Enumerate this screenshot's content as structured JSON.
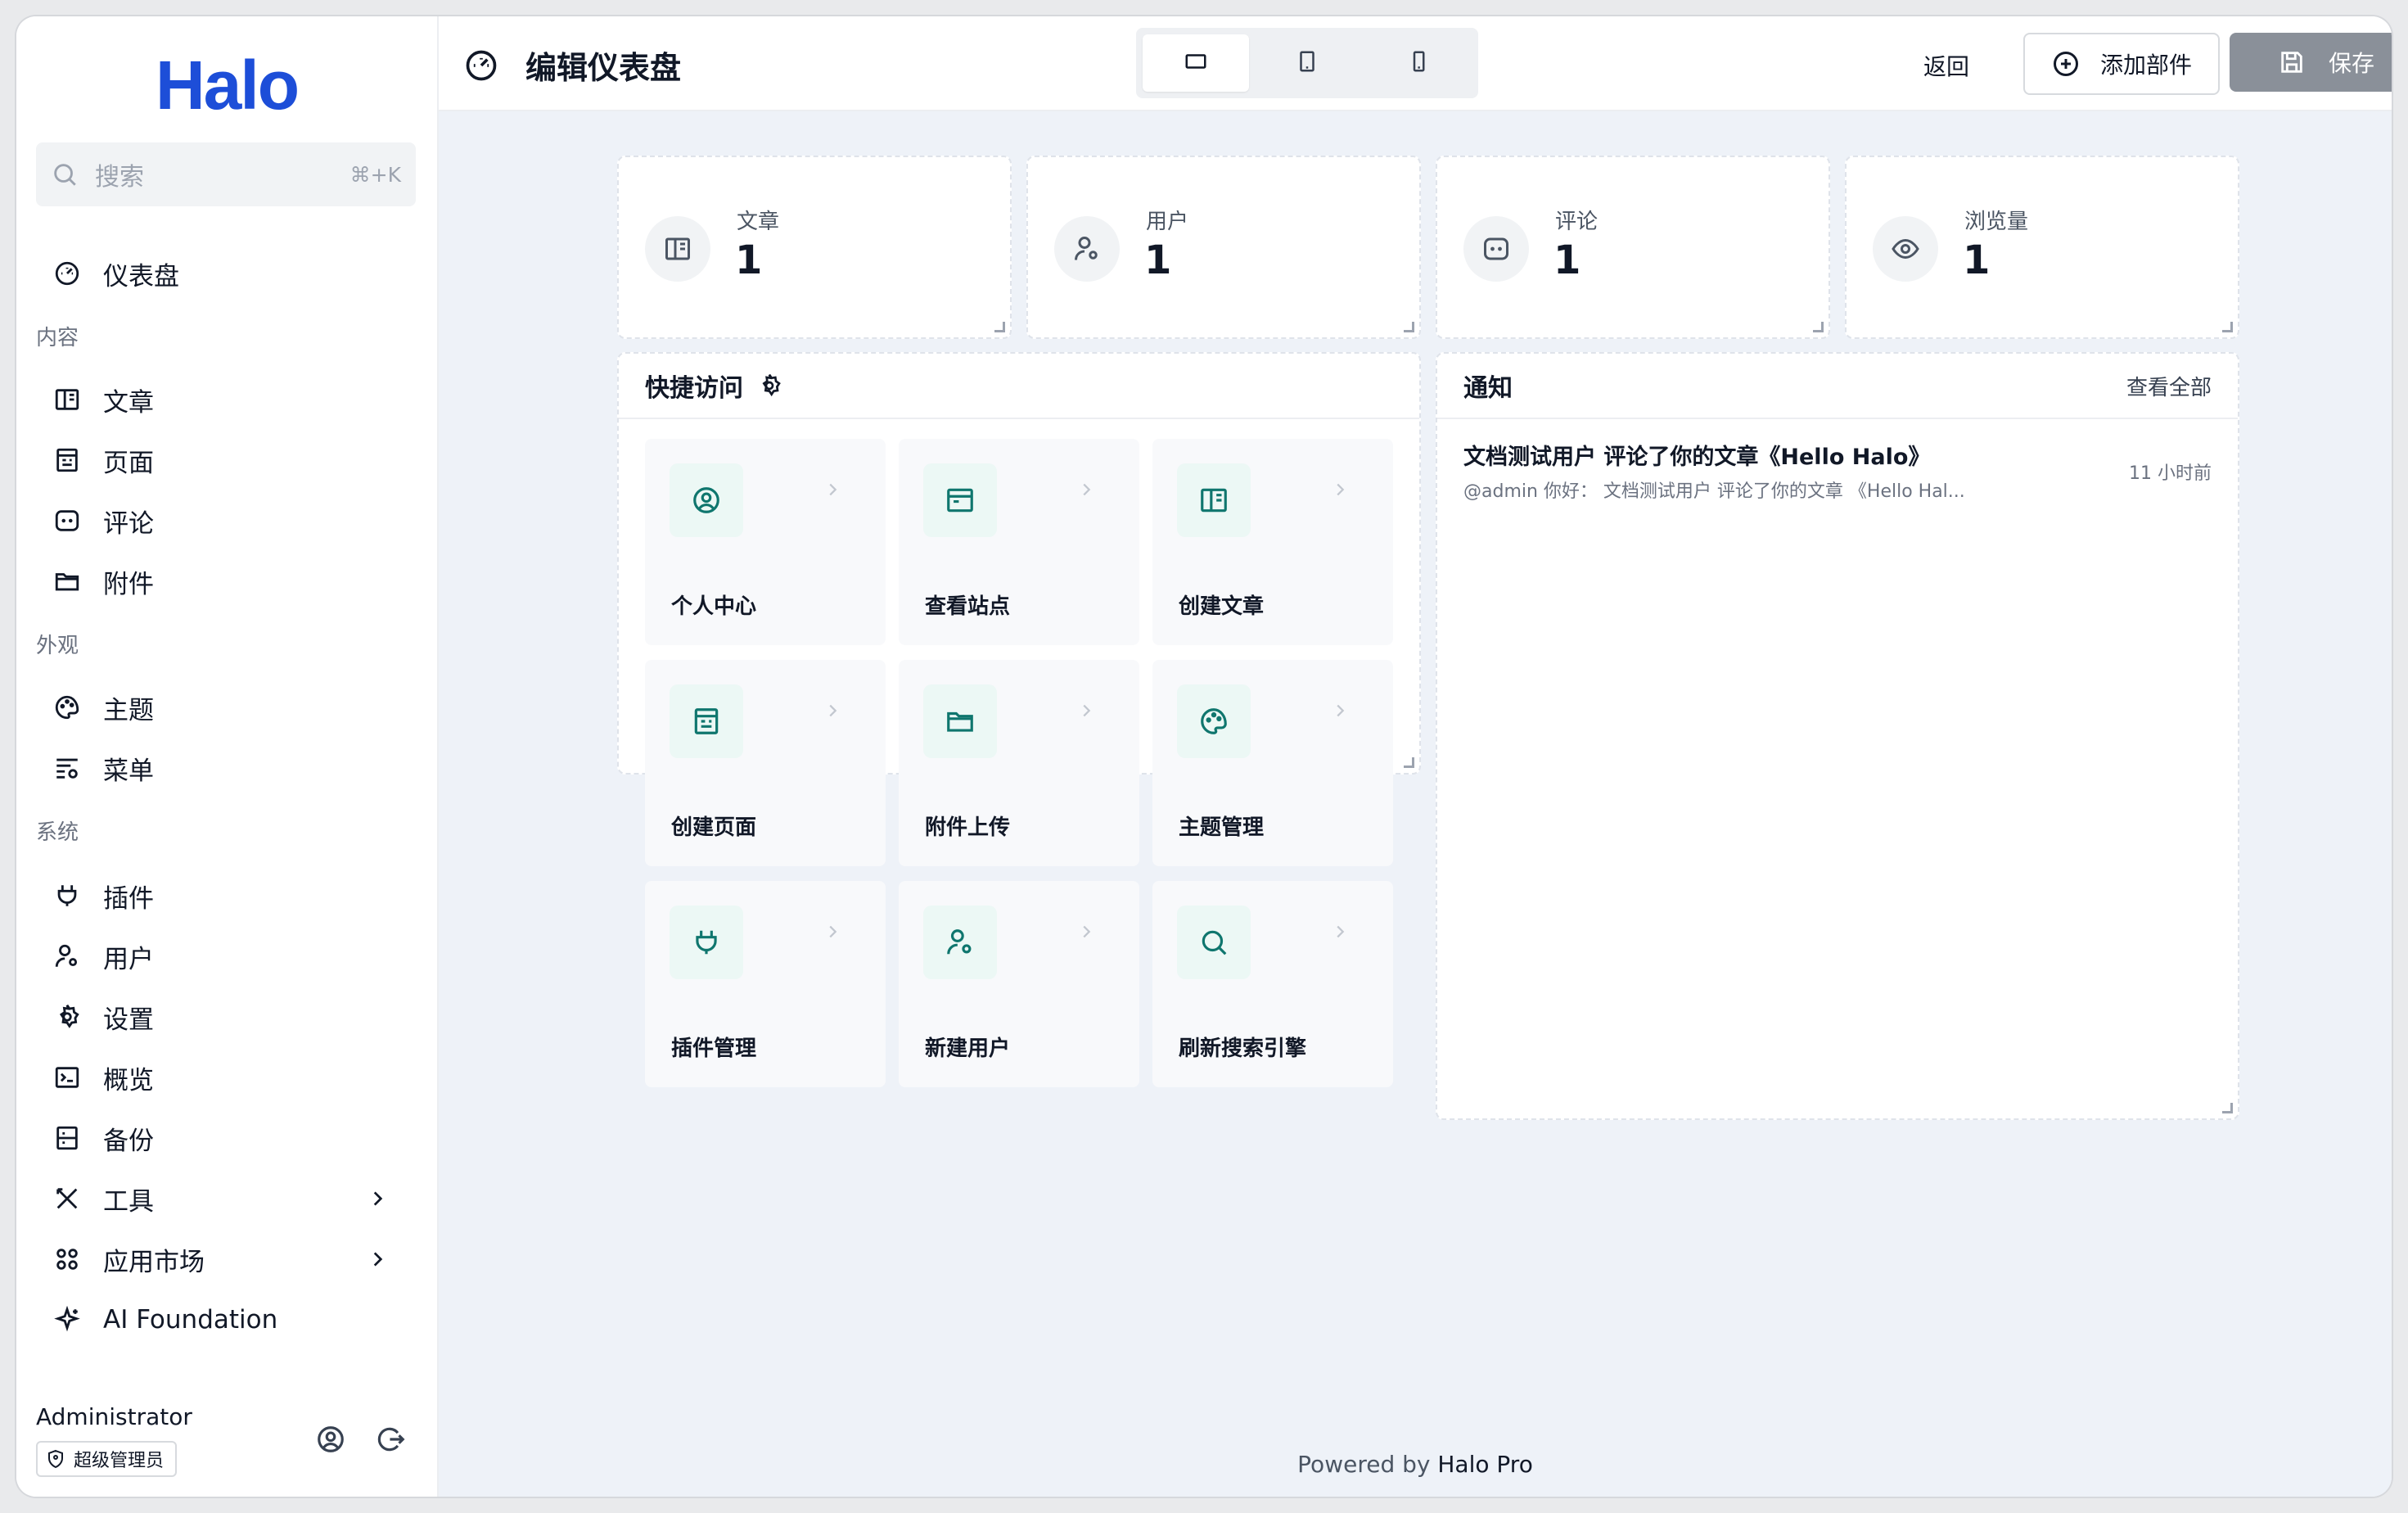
{
  "colors": {
    "brand": "#1d4ed8",
    "accent": "#0f766e",
    "save_disabled": "#8a9099",
    "content_bg": "#eef2f8"
  },
  "sidebar": {
    "logo": "Halo",
    "search": {
      "placeholder": "搜索",
      "shortcut": "⌘+K"
    },
    "dashboard": {
      "label": "仪表盘",
      "icon": "dashboard-icon"
    },
    "groups": [
      {
        "title": "内容",
        "items": [
          {
            "label": "文章",
            "icon": "post-icon"
          },
          {
            "label": "页面",
            "icon": "page-icon"
          },
          {
            "label": "评论",
            "icon": "comment-icon"
          },
          {
            "label": "附件",
            "icon": "folder-icon"
          }
        ]
      },
      {
        "title": "外观",
        "items": [
          {
            "label": "主题",
            "icon": "palette-icon"
          },
          {
            "label": "菜单",
            "icon": "menu-icon"
          }
        ]
      },
      {
        "title": "系统",
        "items": [
          {
            "label": "插件",
            "icon": "plug-icon"
          },
          {
            "label": "用户",
            "icon": "user-settings-icon"
          },
          {
            "label": "设置",
            "icon": "gear-icon"
          },
          {
            "label": "概览",
            "icon": "terminal-icon"
          },
          {
            "label": "备份",
            "icon": "backup-icon"
          },
          {
            "label": "工具",
            "icon": "tools-icon"
          },
          {
            "label": "应用市场",
            "icon": "apps-icon"
          },
          {
            "label": "AI Foundation",
            "icon": "sparkle-icon"
          }
        ]
      }
    ],
    "profile": {
      "name": "Administrator",
      "role": "超级管理员"
    }
  },
  "header": {
    "title": "编辑仪表盘",
    "back_label": "返回",
    "add_widget_label": "添加部件",
    "save_label": "保存",
    "devices": [
      "desktop",
      "tablet",
      "mobile"
    ],
    "active_device": "desktop"
  },
  "stats": [
    {
      "label": "文章",
      "value": "1",
      "icon": "post-icon"
    },
    {
      "label": "用户",
      "value": "1",
      "icon": "user-settings-icon"
    },
    {
      "label": "评论",
      "value": "1",
      "icon": "comment-icon"
    },
    {
      "label": "浏览量",
      "value": "1",
      "icon": "eye-icon"
    }
  ],
  "quick_access": {
    "title": "快捷访问",
    "tiles": [
      {
        "label": "个人中心",
        "icon": "user-circle-icon"
      },
      {
        "label": "查看站点",
        "icon": "browser-icon"
      },
      {
        "label": "创建文章",
        "icon": "post-icon"
      },
      {
        "label": "创建页面",
        "icon": "page-icon"
      },
      {
        "label": "附件上传",
        "icon": "folder-icon"
      },
      {
        "label": "主题管理",
        "icon": "palette-icon"
      },
      {
        "label": "插件管理",
        "icon": "plug-icon"
      },
      {
        "label": "新建用户",
        "icon": "user-settings-icon"
      },
      {
        "label": "刷新搜索引擎",
        "icon": "search-icon"
      }
    ]
  },
  "notifications": {
    "title": "通知",
    "view_all": "查看全部",
    "items": [
      {
        "title": "文档测试用户 评论了你的文章《Hello Halo》",
        "body": "@admin 你好：  文档测试用户  评论了你的文章  《Hello Hal...",
        "time": "11 小时前"
      }
    ]
  },
  "footer": {
    "prefix": "Powered by",
    "brand": "Halo Pro"
  }
}
